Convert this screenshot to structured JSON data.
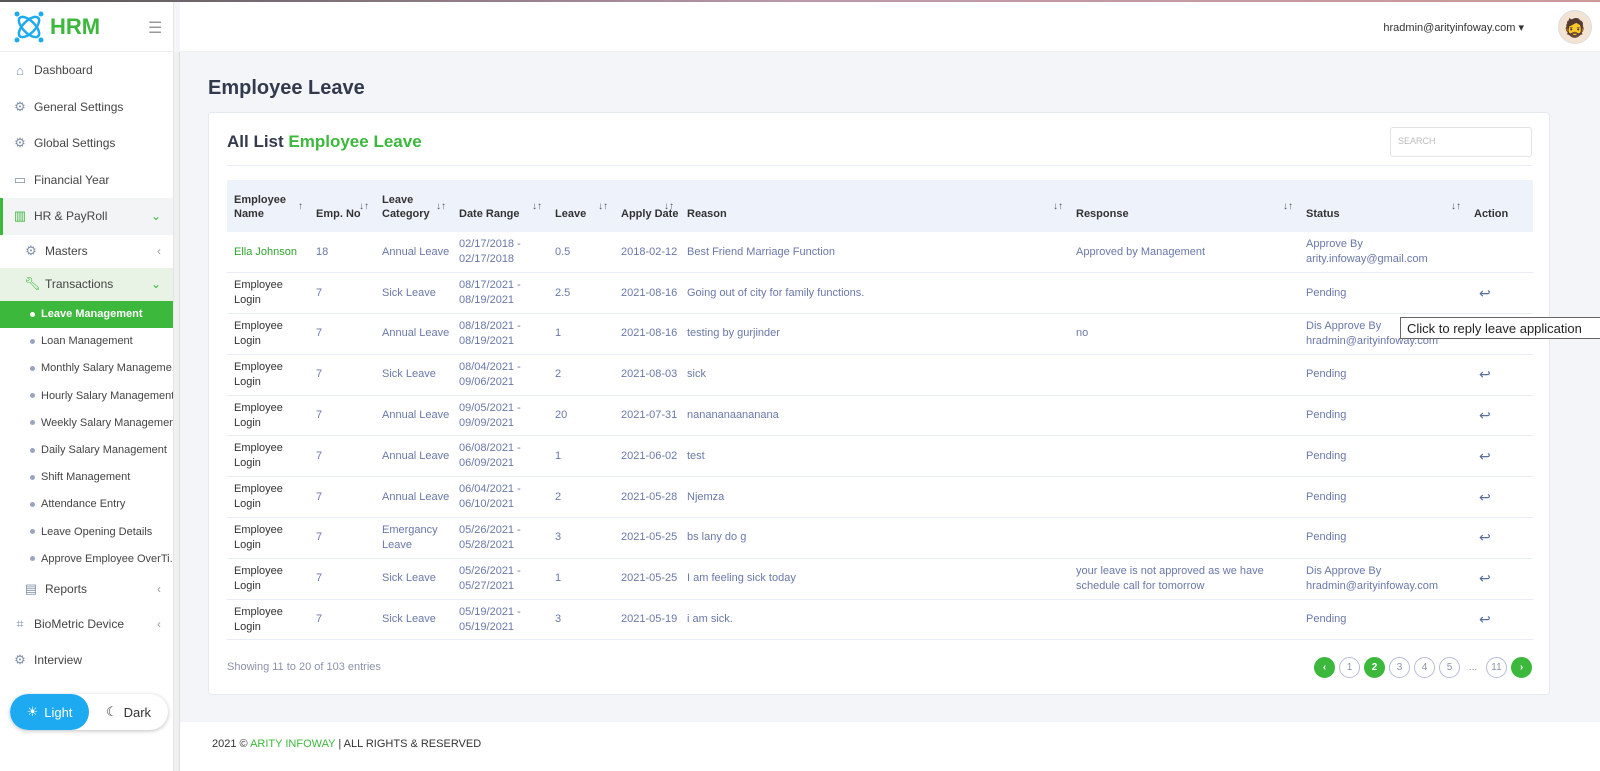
{
  "app": {
    "logo": "HRM",
    "user_email": "hradmin@arityinfoway.com"
  },
  "sidebar": {
    "items": [
      {
        "label": "Dashboard",
        "icon": "home-icon"
      },
      {
        "label": "General Settings",
        "icon": "gear-icon"
      },
      {
        "label": "Global Settings",
        "icon": "gear-icon"
      },
      {
        "label": "Financial Year",
        "icon": "calendar-icon"
      },
      {
        "label": "HR & PayRoll",
        "icon": "barcode-icon"
      }
    ],
    "masters": "Masters",
    "transactions": "Transactions",
    "sub_items": [
      "Leave Management",
      "Loan Management",
      "Monthly Salary Manageme...",
      "Hourly Salary Management",
      "Weekly Salary Management",
      "Daily Salary Management",
      "Shift Management",
      "Attendance Entry",
      "Leave Opening Details",
      "Approve Employee OverTi..."
    ],
    "after": [
      {
        "label": "Reports"
      },
      {
        "label": "BioMetric Device"
      },
      {
        "label": "Interview"
      }
    ],
    "theme": {
      "light": "Light",
      "dark": "Dark"
    }
  },
  "page": {
    "title": "Employee Leave",
    "card_title": "All List",
    "card_title_accent": "Employee Leave",
    "search_placeholder": "SEARCH"
  },
  "table": {
    "headers": [
      "Employee Name",
      "Emp. No",
      "Leave Category",
      "Date Range",
      "Leave",
      "Apply Date",
      "Reason",
      "Response",
      "Status",
      "Action"
    ],
    "rows": [
      [
        "Ella Johnson",
        "18",
        "Annual Leave",
        "02/17/2018 - 02/17/2018",
        "0.5",
        "2018-02-12",
        "Best Friend Marriage Function",
        "Approved by Management",
        "Approve By arity.infoway@gmail.com"
      ],
      [
        "Employee Login",
        "7",
        "Sick Leave",
        "08/17/2021 - 08/19/2021",
        "2.5",
        "2021-08-16",
        "Going out of city for family functions.",
        "",
        "Pending"
      ],
      [
        "Employee Login",
        "7",
        "Annual Leave",
        "08/18/2021 - 08/19/2021",
        "1",
        "2021-08-16",
        "testing by gurjinder",
        "no",
        "Dis Approve By hradmin@arityinfoway.com"
      ],
      [
        "Employee Login",
        "7",
        "Sick Leave",
        "08/04/2021 - 09/06/2021",
        "2",
        "2021-08-03",
        "sick",
        "",
        "Pending"
      ],
      [
        "Employee Login",
        "7",
        "Annual Leave",
        "09/05/2021 - 09/09/2021",
        "20",
        "2021-07-31",
        "nanananaananana",
        "",
        "Pending"
      ],
      [
        "Employee Login",
        "7",
        "Annual Leave",
        "06/08/2021 - 06/09/2021",
        "1",
        "2021-06-02",
        "test",
        "",
        "Pending"
      ],
      [
        "Employee Login",
        "7",
        "Annual Leave",
        "06/04/2021 - 06/10/2021",
        "2",
        "2021-05-28",
        "Njemza",
        "",
        "Pending"
      ],
      [
        "Employee Login",
        "7",
        "Emergancy Leave",
        "05/26/2021 - 05/28/2021",
        "3",
        "2021-05-25",
        "bs lany do g",
        "",
        "Pending"
      ],
      [
        "Employee Login",
        "7",
        "Sick Leave",
        "05/26/2021 - 05/27/2021",
        "1",
        "2021-05-25",
        "I am feeling sick today",
        "your leave is not approved as we have schedule call for tomorrow",
        "Dis Approve By hradmin@arityinfoway.com"
      ],
      [
        "Employee Login",
        "7",
        "Sick Leave",
        "05/19/2021 - 05/19/2021",
        "3",
        "2021-05-19",
        "i am sick.",
        "",
        "Pending"
      ]
    ],
    "reply_rows": [
      false,
      true,
      false,
      true,
      true,
      true,
      true,
      true,
      true,
      true
    ]
  },
  "info": "Showing 11 to 20 of 103 entries",
  "pagination": {
    "pages": [
      "1",
      "2",
      "3",
      "4",
      "5",
      "...",
      "11"
    ],
    "current": "2"
  },
  "tooltip": "Click to reply leave application",
  "footer": {
    "prefix": "2021 ©",
    "brand": "ARITY INFOWAY",
    "suffix": "| ALL RIGHTS & RESERVED"
  },
  "colors": {
    "accent": "#3cb83c",
    "light_toggle": "#1eaaf1"
  }
}
